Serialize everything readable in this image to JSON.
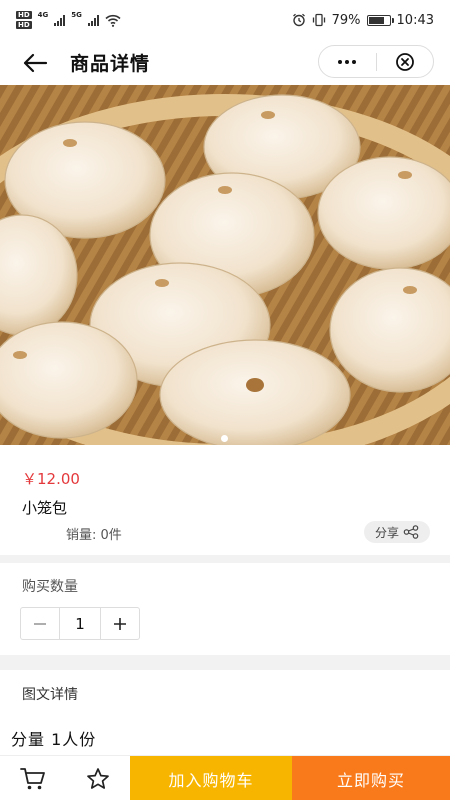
{
  "status_bar": {
    "hd1": "HD",
    "hd2": "HD",
    "net1": "4G",
    "net2": "5G",
    "battery_pct": "79%",
    "time": "10:43",
    "battery_level": 0.79
  },
  "navbar": {
    "title": "商品详情",
    "back_icon": "arrow-left-icon",
    "more_icon": "more-dots-icon",
    "close_icon": "close-circle-icon"
  },
  "banner": {
    "image_subject": "steamed-soup-dumplings-in-bamboo-basket",
    "slide_count": 1,
    "active_slide": 1
  },
  "product": {
    "price": "￥12.00",
    "name": "小笼包",
    "sales": "销量: 0件",
    "share_label": "分享",
    "price_color": "#e4393c"
  },
  "quantity": {
    "label": "购买数量",
    "value": "1",
    "minus_icon": "minus-icon",
    "plus_icon": "plus-icon"
  },
  "detail": {
    "title": "图文详情",
    "text": "分量 1人份"
  },
  "bottom_bar": {
    "cart_icon": "cart-icon",
    "favorite_icon": "star-icon",
    "add_to_cart": "加入购物车",
    "buy_now": "立即购买",
    "add_to_cart_color": "#f8b500",
    "buy_now_color": "#f97a1a"
  }
}
